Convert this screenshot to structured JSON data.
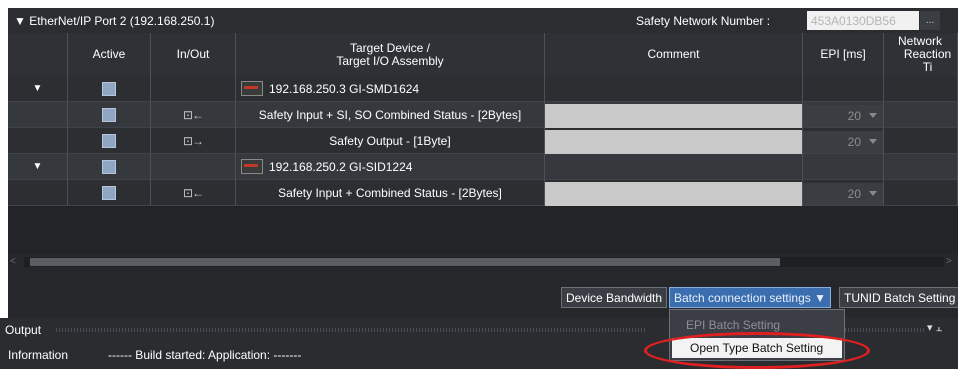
{
  "header": {
    "title": "▼ EtherNet/IP Port 2 (192.168.250.1)",
    "snn_label": "Safety Network Number :",
    "snn_value": "453A0130DB56",
    "snn_button": "..."
  },
  "columns": {
    "active": "Active",
    "inout": "In/Out",
    "target_line1": "Target Device /",
    "target_line2": "Target I/O Assembly",
    "comment": "Comment",
    "epi": "EPI [ms]",
    "network_line1": "Network",
    "network_line2": "Reaction Ti"
  },
  "rows": [
    {
      "expander": "▼",
      "target": "192.168.250.3 GI-SMD1624",
      "type": "device"
    },
    {
      "io": "input",
      "io_icon": "⊡←",
      "target": "Safety Input + SI, SO Combined Status - [2Bytes]",
      "epi": "20",
      "type": "assembly"
    },
    {
      "io": "output",
      "io_icon": "⊡→",
      "target": "Safety Output - [1Byte]",
      "epi": "20",
      "type": "assembly"
    },
    {
      "expander": "▼",
      "target": "192.168.250.2 GI-SID1224",
      "type": "device"
    },
    {
      "io": "input",
      "io_icon": "⊡←",
      "target": "Safety Input + Combined Status - [2Bytes]",
      "epi": "20",
      "type": "assembly"
    }
  ],
  "scroll": {
    "left": "<",
    "right": ">"
  },
  "toolbar": {
    "device_bandwidth": "Device Bandwidth",
    "batch_connection": "Batch connection settings ▼",
    "tunid": "TUNID Batch Setting"
  },
  "output": {
    "title": "Output",
    "pin": "▾ ⫠",
    "info_label": "Information",
    "message": "------ Build started: Application: -------"
  },
  "menu": {
    "item1": "EPI Batch Setting",
    "item2": "Open Type Batch Setting"
  }
}
